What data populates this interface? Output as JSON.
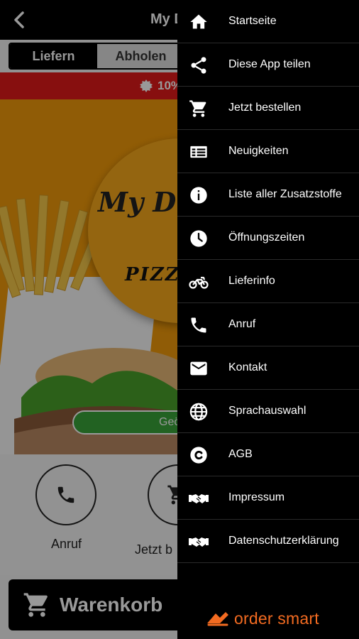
{
  "app": {
    "title": "My D",
    "tabs": [
      {
        "label": "Liefern",
        "active": true
      },
      {
        "label": "Abholen",
        "active": false
      }
    ],
    "promo_text": "10%",
    "hero": {
      "logo_text": "My D",
      "subtitle": "PIZZA",
      "button_text": "Geö"
    },
    "actions": [
      {
        "label": "Anruf",
        "icon": "phone-icon"
      },
      {
        "label": "Jetzt b",
        "icon": "cart-icon"
      }
    ],
    "cart_label": "Warenkorb"
  },
  "drawer": {
    "items": [
      {
        "label": "Startseite",
        "icon": "home-icon"
      },
      {
        "label": "Diese App teilen",
        "icon": "share-icon"
      },
      {
        "label": "Jetzt bestellen",
        "icon": "cart-icon"
      },
      {
        "label": "Neuigkeiten",
        "icon": "news-icon"
      },
      {
        "label": "Liste aller Zusatzstoffe",
        "icon": "info-icon"
      },
      {
        "label": "Öffnungszeiten",
        "icon": "clock-icon"
      },
      {
        "label": "Lieferinfo",
        "icon": "motorbike-icon"
      },
      {
        "label": "Anruf",
        "icon": "phone-icon"
      },
      {
        "label": "Kontakt",
        "icon": "mail-icon"
      },
      {
        "label": "Sprachauswahl",
        "icon": "globe-icon"
      },
      {
        "label": "AGB",
        "icon": "copyright-icon"
      },
      {
        "label": "Impressum",
        "icon": "handshake-icon"
      },
      {
        "label": "Datenschutzerklärung",
        "icon": "handshake-icon"
      }
    ],
    "brand_text": "order smart"
  },
  "colors": {
    "background": "#000000",
    "promo_red": "#e21a1a",
    "hero_orange": "#f19a0a",
    "button_green": "#3aa43a",
    "brand_orange": "#f36b21"
  }
}
